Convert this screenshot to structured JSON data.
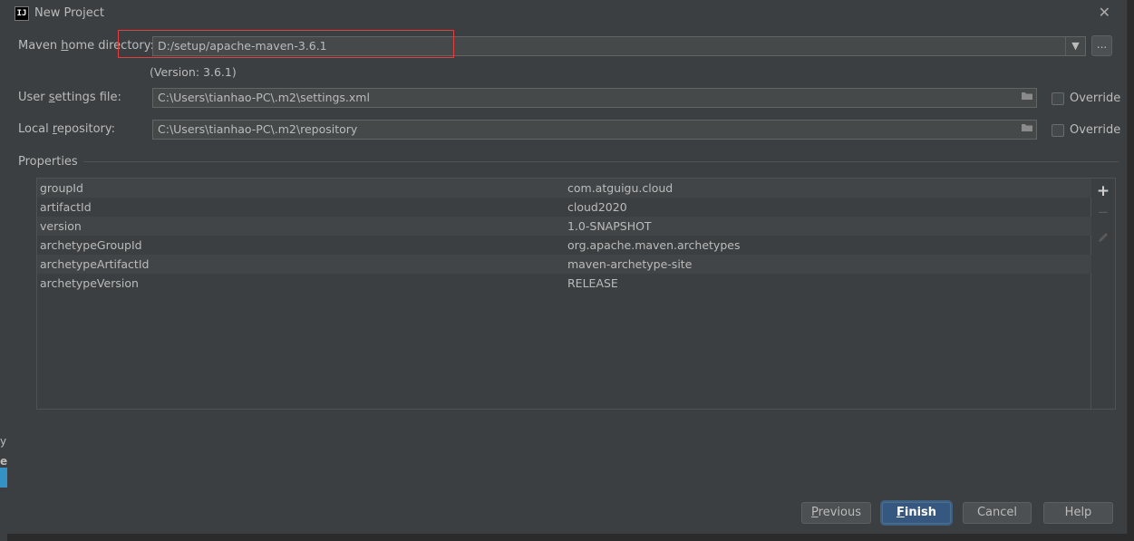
{
  "backdrop": {
    "frag1": "yp",
    "frag2": "et"
  },
  "window": {
    "title": "New Project",
    "app_icon": "IJ"
  },
  "maven": {
    "home_label_pre": "Maven ",
    "home_label_mn": "h",
    "home_label_post": "ome directory:",
    "home_value": "D:/setup/apache-maven-3.6.1",
    "version_text": "(Version: 3.6.1)",
    "settings_label_pre": "User ",
    "settings_label_mn": "s",
    "settings_label_post": "ettings file:",
    "settings_value": "C:\\Users\\tianhao-PC\\.m2\\settings.xml",
    "repo_label_pre": "Local ",
    "repo_label_mn": "r",
    "repo_label_post": "epository:",
    "repo_value": "C:\\Users\\tianhao-PC\\.m2\\repository",
    "override_label": "Override",
    "browse_label": "..."
  },
  "properties": {
    "title": "Properties",
    "rows": [
      {
        "key": "groupId",
        "value": "com.atguigu.cloud"
      },
      {
        "key": "artifactId",
        "value": "cloud2020"
      },
      {
        "key": "version",
        "value": "1.0-SNAPSHOT"
      },
      {
        "key": "archetypeGroupId",
        "value": "org.apache.maven.archetypes"
      },
      {
        "key": "archetypeArtifactId",
        "value": "maven-archetype-site"
      },
      {
        "key": "archetypeVersion",
        "value": "RELEASE"
      }
    ],
    "add_glyph": "+",
    "remove_glyph": "−"
  },
  "buttons": {
    "previous_mn": "P",
    "previous_rest": "revious",
    "finish_mn": "F",
    "finish_rest": "inish",
    "cancel": "Cancel",
    "help": "Help"
  },
  "colors": {
    "accent": "#365880",
    "highlight_border": "#e04040",
    "background": "#3c3f41"
  }
}
